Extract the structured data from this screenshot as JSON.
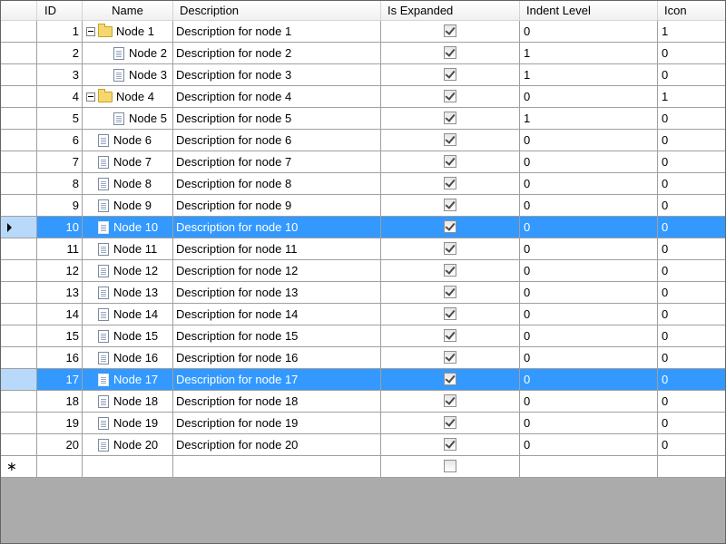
{
  "columns": {
    "id": "ID",
    "name": "Name",
    "description": "Description",
    "expanded": "Is Expanded",
    "indent": "Indent Level",
    "icon": "Icon"
  },
  "rows": [
    {
      "id": "1",
      "name": "Node 1",
      "desc": "Description for node 1",
      "expanded": true,
      "indent": "0",
      "icon": "1",
      "level": 0,
      "kind": "folder"
    },
    {
      "id": "2",
      "name": "Node 2",
      "desc": "Description for node 2",
      "expanded": true,
      "indent": "1",
      "icon": "0",
      "level": 1,
      "kind": "doc"
    },
    {
      "id": "3",
      "name": "Node 3",
      "desc": "Description for node 3",
      "expanded": true,
      "indent": "1",
      "icon": "0",
      "level": 1,
      "kind": "doc"
    },
    {
      "id": "4",
      "name": "Node 4",
      "desc": "Description for node 4",
      "expanded": true,
      "indent": "0",
      "icon": "1",
      "level": 0,
      "kind": "folder"
    },
    {
      "id": "5",
      "name": "Node 5",
      "desc": "Description for node 5",
      "expanded": true,
      "indent": "1",
      "icon": "0",
      "level": 1,
      "kind": "doc"
    },
    {
      "id": "6",
      "name": "Node 6",
      "desc": "Description for node 6",
      "expanded": true,
      "indent": "0",
      "icon": "0",
      "level": 0,
      "kind": "doc"
    },
    {
      "id": "7",
      "name": "Node 7",
      "desc": "Description for node 7",
      "expanded": true,
      "indent": "0",
      "icon": "0",
      "level": 0,
      "kind": "doc"
    },
    {
      "id": "8",
      "name": "Node 8",
      "desc": "Description for node 8",
      "expanded": true,
      "indent": "0",
      "icon": "0",
      "level": 0,
      "kind": "doc"
    },
    {
      "id": "9",
      "name": "Node 9",
      "desc": "Description for node 9",
      "expanded": true,
      "indent": "0",
      "icon": "0",
      "level": 0,
      "kind": "doc"
    },
    {
      "id": "10",
      "name": "Node 10",
      "desc": "Description for node 10",
      "expanded": true,
      "indent": "0",
      "icon": "0",
      "level": 0,
      "kind": "doc",
      "selected": true,
      "current": true
    },
    {
      "id": "11",
      "name": "Node 11",
      "desc": "Description for node 11",
      "expanded": true,
      "indent": "0",
      "icon": "0",
      "level": 0,
      "kind": "doc"
    },
    {
      "id": "12",
      "name": "Node 12",
      "desc": "Description for node 12",
      "expanded": true,
      "indent": "0",
      "icon": "0",
      "level": 0,
      "kind": "doc"
    },
    {
      "id": "13",
      "name": "Node 13",
      "desc": "Description for node 13",
      "expanded": true,
      "indent": "0",
      "icon": "0",
      "level": 0,
      "kind": "doc"
    },
    {
      "id": "14",
      "name": "Node 14",
      "desc": "Description for node 14",
      "expanded": true,
      "indent": "0",
      "icon": "0",
      "level": 0,
      "kind": "doc"
    },
    {
      "id": "15",
      "name": "Node 15",
      "desc": "Description for node 15",
      "expanded": true,
      "indent": "0",
      "icon": "0",
      "level": 0,
      "kind": "doc"
    },
    {
      "id": "16",
      "name": "Node 16",
      "desc": "Description for node 16",
      "expanded": true,
      "indent": "0",
      "icon": "0",
      "level": 0,
      "kind": "doc"
    },
    {
      "id": "17",
      "name": "Node 17",
      "desc": "Description for node 17",
      "expanded": true,
      "indent": "0",
      "icon": "0",
      "level": 0,
      "kind": "doc",
      "selected": true
    },
    {
      "id": "18",
      "name": "Node 18",
      "desc": "Description for node 18",
      "expanded": true,
      "indent": "0",
      "icon": "0",
      "level": 0,
      "kind": "doc"
    },
    {
      "id": "19",
      "name": "Node 19",
      "desc": "Description for node 19",
      "expanded": true,
      "indent": "0",
      "icon": "0",
      "level": 0,
      "kind": "doc"
    },
    {
      "id": "20",
      "name": "Node 20",
      "desc": "Description for node 20",
      "expanded": true,
      "indent": "0",
      "icon": "0",
      "level": 0,
      "kind": "doc"
    }
  ],
  "new_row": {
    "marker": "∗",
    "expanded": false
  },
  "colors": {
    "selection": "#3399ff",
    "selection_header": "#b9d9fa",
    "grid_line": "#a0a0a0",
    "empty_area": "#ababab"
  }
}
